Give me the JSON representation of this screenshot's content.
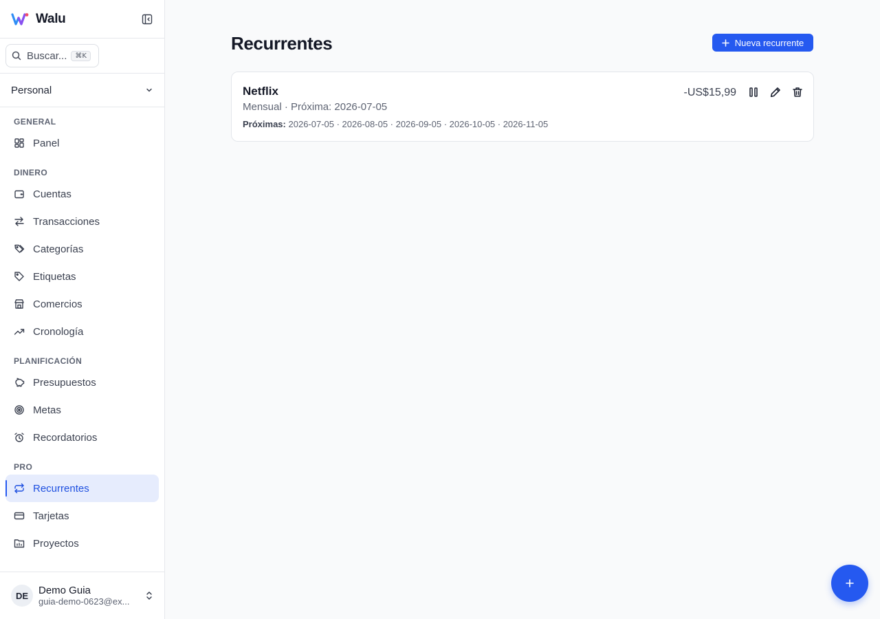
{
  "app": {
    "name": "Walu"
  },
  "sidebar": {
    "search": {
      "placeholder": "Buscar...",
      "shortcut": "⌘K"
    },
    "workspace": "Personal",
    "sections": {
      "general": "GENERAL",
      "dinero": "DINERO",
      "planificacion": "PLANIFICACIÓN",
      "pro": "PRO"
    },
    "items": {
      "panel": "Panel",
      "cuentas": "Cuentas",
      "transacciones": "Transacciones",
      "categorias": "Categorías",
      "etiquetas": "Etiquetas",
      "comercios": "Comercios",
      "cronologia": "Cronología",
      "presupuestos": "Presupuestos",
      "metas": "Metas",
      "recordatorios": "Recordatorios",
      "recurrentes": "Recurrentes",
      "tarjetas": "Tarjetas",
      "proyectos": "Proyectos"
    },
    "active_item": "recurrentes",
    "user": {
      "initials": "DE",
      "name": "Demo Guia",
      "email": "guia-demo-0623@ex..."
    }
  },
  "main": {
    "title": "Recurrentes",
    "new_button": "Nueva recurrente",
    "recurring": [
      {
        "name": "Netflix",
        "frequency": "Mensual",
        "next_label": "Próxima:",
        "next_date": "2026-07-05",
        "upcoming_label": "Próximas:",
        "upcoming": "2026-07-05 · 2026-08-05 · 2026-09-05 · 2026-10-05 · 2026-11-05",
        "amount": "-US$15,99"
      }
    ]
  },
  "icons": {
    "collapse": "sidebar-collapse-icon",
    "search": "search-icon",
    "chevron": "chevron-down-icon",
    "pause": "pause-icon",
    "edit": "pencil-icon",
    "delete": "trash-icon",
    "fab": "plus-icon"
  },
  "colors": {
    "accent": "#2559f0",
    "active_bg": "#e6ecfd"
  }
}
